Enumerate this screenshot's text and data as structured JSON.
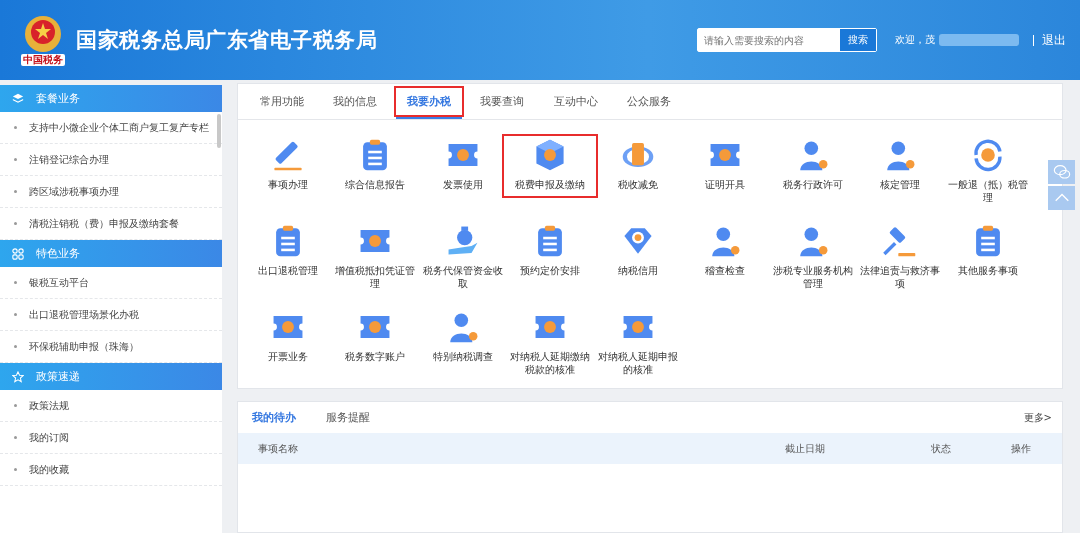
{
  "header": {
    "logo_caption": "中国税务",
    "title": "国家税务总局广东省电子税务局",
    "search": {
      "placeholder": "请输入需要搜索的内容",
      "button": "搜索"
    },
    "welcome": "欢迎，茂",
    "logout": "退出"
  },
  "sidebar": {
    "groups": [
      {
        "title": "套餐业务",
        "kind": "layers",
        "items": [
          "支持中小微企业个体工商户复工复产专栏",
          "注销登记综合办理",
          "跨区域涉税事项办理",
          "清税注销税（费）申报及缴纳套餐"
        ]
      },
      {
        "title": "特色业务",
        "kind": "grid",
        "items": [
          "银税互动平台",
          "出口退税管理场景化办税",
          "环保税辅助申报（珠海）"
        ]
      },
      {
        "title": "政策速递",
        "kind": "star",
        "items": [
          "政策法规",
          "我的订阅",
          "我的收藏"
        ]
      }
    ]
  },
  "tabs": [
    {
      "label": "常用功能",
      "selected": false,
      "highlighted": false
    },
    {
      "label": "我的信息",
      "selected": false,
      "highlighted": false
    },
    {
      "label": "我要办税",
      "selected": true,
      "highlighted": true
    },
    {
      "label": "我要查询",
      "selected": false,
      "highlighted": false
    },
    {
      "label": "互动中心",
      "selected": false,
      "highlighted": false
    },
    {
      "label": "公众服务",
      "selected": false,
      "highlighted": false
    }
  ],
  "services": [
    {
      "label": "事项办理",
      "highlighted": false
    },
    {
      "label": "综合信息报告",
      "highlighted": false
    },
    {
      "label": "发票使用",
      "highlighted": false
    },
    {
      "label": "税费申报及缴纳",
      "highlighted": true
    },
    {
      "label": "税收减免",
      "highlighted": false
    },
    {
      "label": "证明开具",
      "highlighted": false
    },
    {
      "label": "税务行政许可",
      "highlighted": false
    },
    {
      "label": "核定管理",
      "highlighted": false
    },
    {
      "label": "一般退（抵）税管理",
      "highlighted": false
    },
    {
      "label": "出口退税管理",
      "highlighted": false
    },
    {
      "label": "增值税抵扣凭证管理",
      "highlighted": false
    },
    {
      "label": "税务代保管资金收取",
      "highlighted": false
    },
    {
      "label": "预约定价安排",
      "highlighted": false
    },
    {
      "label": "纳税信用",
      "highlighted": false
    },
    {
      "label": "稽查检查",
      "highlighted": false
    },
    {
      "label": "涉税专业服务机构管理",
      "highlighted": false
    },
    {
      "label": "法律追责与救济事项",
      "highlighted": false
    },
    {
      "label": "其他服务事项",
      "highlighted": false
    },
    {
      "label": "开票业务",
      "highlighted": false
    },
    {
      "label": "税务数字账户",
      "highlighted": false
    },
    {
      "label": "特别纳税调查",
      "highlighted": false
    },
    {
      "label": "对纳税人延期缴纳税款的核准",
      "highlighted": false
    },
    {
      "label": "对纳税人延期申报的核准",
      "highlighted": false
    }
  ],
  "tasks": {
    "tabs": [
      {
        "label": "我的待办",
        "selected": true
      },
      {
        "label": "服务提醒",
        "selected": false
      }
    ],
    "more": "更多>",
    "columns": [
      "事项名称",
      "截止日期",
      "状态",
      "操作"
    ]
  }
}
